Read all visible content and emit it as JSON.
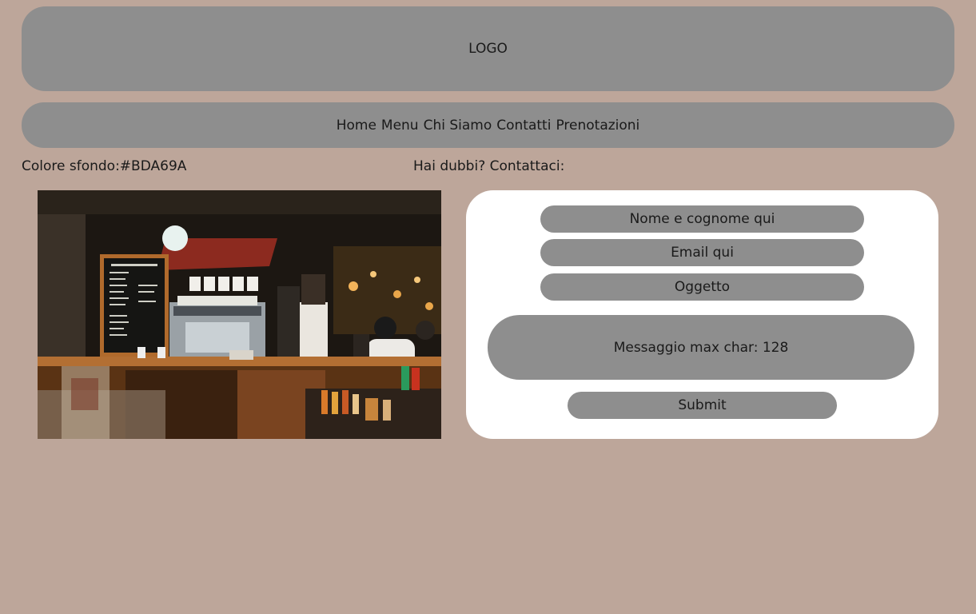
{
  "header": {
    "logo_text": "LOGO"
  },
  "nav": {
    "items": [
      {
        "label": "Home"
      },
      {
        "label": "Menu"
      },
      {
        "label": "Chi Siamo"
      },
      {
        "label": "Contatti"
      },
      {
        "label": "Prenotazioni"
      }
    ]
  },
  "info": {
    "background_label": "Colore sfondo:#BDA69A",
    "contact_label": "Hai dubbi? Contattaci:"
  },
  "form": {
    "name_placeholder": "Nome e cognome qui",
    "email_placeholder": "Email qui",
    "subject_placeholder": "Oggetto",
    "message_placeholder": "Messaggio max char: 128",
    "submit_label": "Submit"
  },
  "colors": {
    "page_background": "#BDA69A",
    "bar_background": "#8E8E8E",
    "card_background": "#FFFFFF"
  }
}
